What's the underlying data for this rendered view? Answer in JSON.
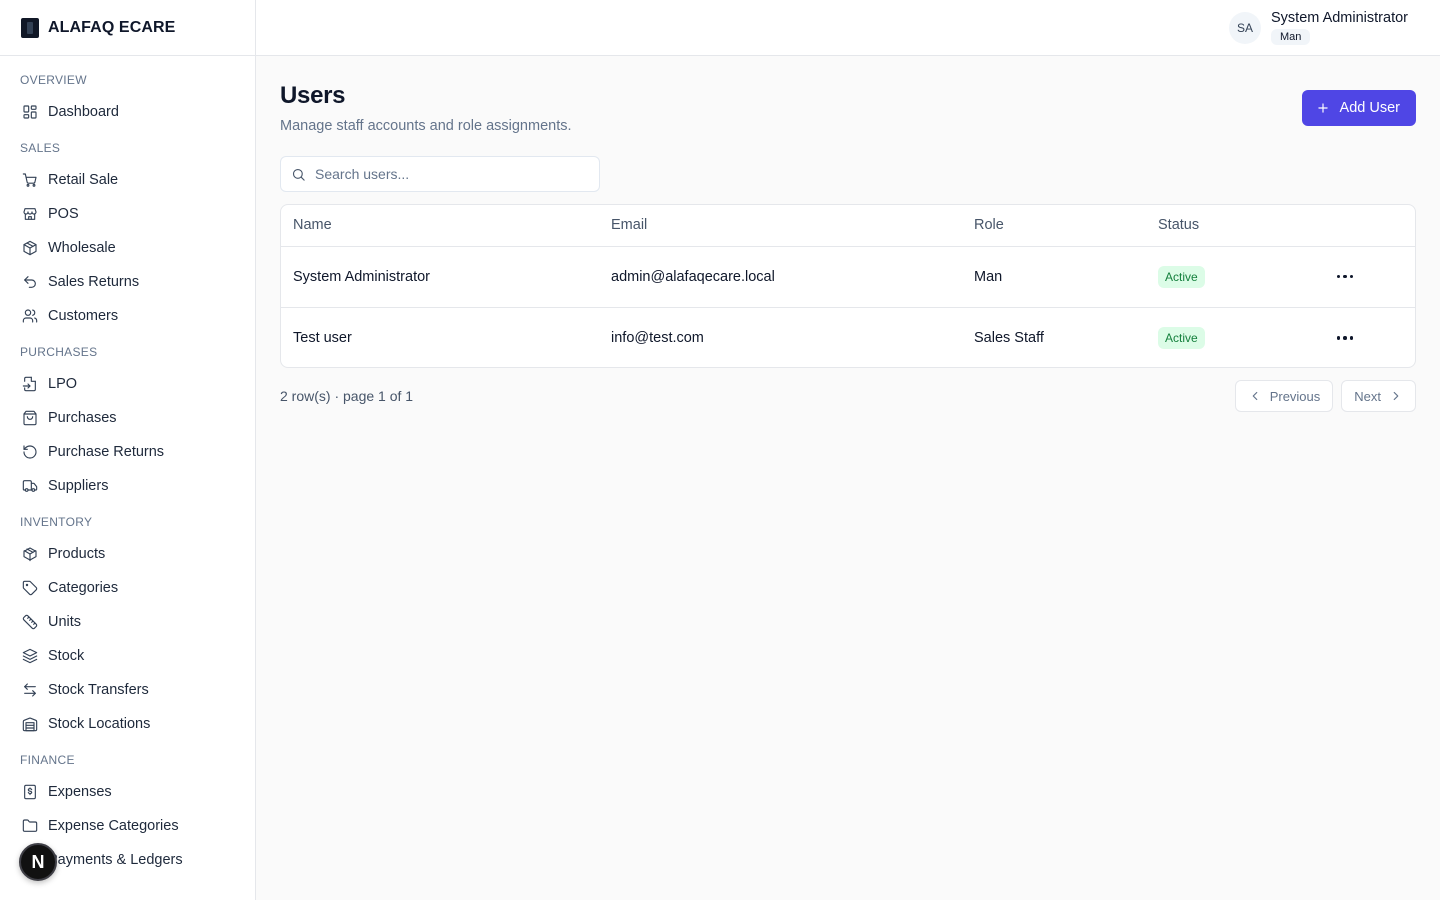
{
  "brand": {
    "name": "ALAFAQ ECARE"
  },
  "sidebar": {
    "sections": [
      {
        "heading": "OVERVIEW",
        "items": [
          {
            "label": "Dashboard",
            "icon": "layout-dashboard-icon"
          }
        ]
      },
      {
        "heading": "SALES",
        "items": [
          {
            "label": "Retail Sale",
            "icon": "shopping-cart-icon"
          },
          {
            "label": "POS",
            "icon": "store-icon"
          },
          {
            "label": "Wholesale",
            "icon": "package-open-icon"
          },
          {
            "label": "Sales Returns",
            "icon": "undo-icon"
          },
          {
            "label": "Customers",
            "icon": "users-icon"
          }
        ]
      },
      {
        "heading": "PURCHASES",
        "items": [
          {
            "label": "LPO",
            "icon": "file-import-icon"
          },
          {
            "label": "Purchases",
            "icon": "shopping-bag-icon"
          },
          {
            "label": "Purchase Returns",
            "icon": "rotate-ccw-icon"
          },
          {
            "label": "Suppliers",
            "icon": "truck-icon"
          }
        ]
      },
      {
        "heading": "INVENTORY",
        "items": [
          {
            "label": "Products",
            "icon": "package-icon"
          },
          {
            "label": "Categories",
            "icon": "tag-icon"
          },
          {
            "label": "Units",
            "icon": "ruler-icon"
          },
          {
            "label": "Stock",
            "icon": "layers-icon"
          },
          {
            "label": "Stock Transfers",
            "icon": "arrow-left-right-icon"
          },
          {
            "label": "Stock Locations",
            "icon": "warehouse-icon"
          }
        ]
      },
      {
        "heading": "FINANCE",
        "items": [
          {
            "label": "Expenses",
            "icon": "receipt-dollar-icon"
          },
          {
            "label": "Expense Categories",
            "icon": "folder-icon"
          },
          {
            "label": "Payments & Ledgers",
            "icon": "wallet-icon"
          }
        ]
      }
    ]
  },
  "header": {
    "user": {
      "initials": "SA",
      "name": "System Administrator",
      "role": "Man"
    }
  },
  "page": {
    "title": "Users",
    "subtitle": "Manage staff accounts and role assignments.",
    "add_button_label": "Add User",
    "search_placeholder": "Search users..."
  },
  "table": {
    "columns": [
      "Name",
      "Email",
      "Role",
      "Status"
    ],
    "rows": [
      {
        "name": "System Administrator",
        "email": "admin@alafaqecare.local",
        "role": "Man",
        "status": "Active"
      },
      {
        "name": "Test user",
        "email": "info@test.com",
        "role": "Sales Staff",
        "status": "Active"
      }
    ]
  },
  "pagination": {
    "info": "2 row(s) · page 1 of 1",
    "previous_label": "Previous",
    "next_label": "Next"
  },
  "dev_badge": {
    "letter": "N"
  },
  "colors": {
    "accent": "#4f46e5",
    "active_badge_bg": "#dcfce7",
    "active_badge_text": "#15803d"
  }
}
